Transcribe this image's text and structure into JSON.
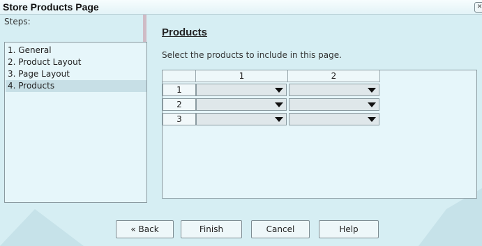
{
  "window": {
    "title": "Store Products Page",
    "close_icon": "close-icon"
  },
  "steps": {
    "label": "Steps:",
    "items": [
      {
        "label": "1. General"
      },
      {
        "label": "2. Product Layout"
      },
      {
        "label": "3. Page Layout"
      },
      {
        "label": "4. Products",
        "selected": true
      }
    ]
  },
  "main": {
    "title": "Products",
    "description": "Select the products to include in this page.",
    "table": {
      "columns": [
        "1",
        "2"
      ],
      "rows": [
        "1",
        "2",
        "3"
      ]
    }
  },
  "buttons": {
    "back": "Back",
    "finish": "Finish",
    "cancel": "Cancel",
    "help": "Help"
  },
  "colors": {
    "background": "#d6eef3",
    "watermark": "#d9b3bb",
    "selection": "#c7dfe6"
  }
}
